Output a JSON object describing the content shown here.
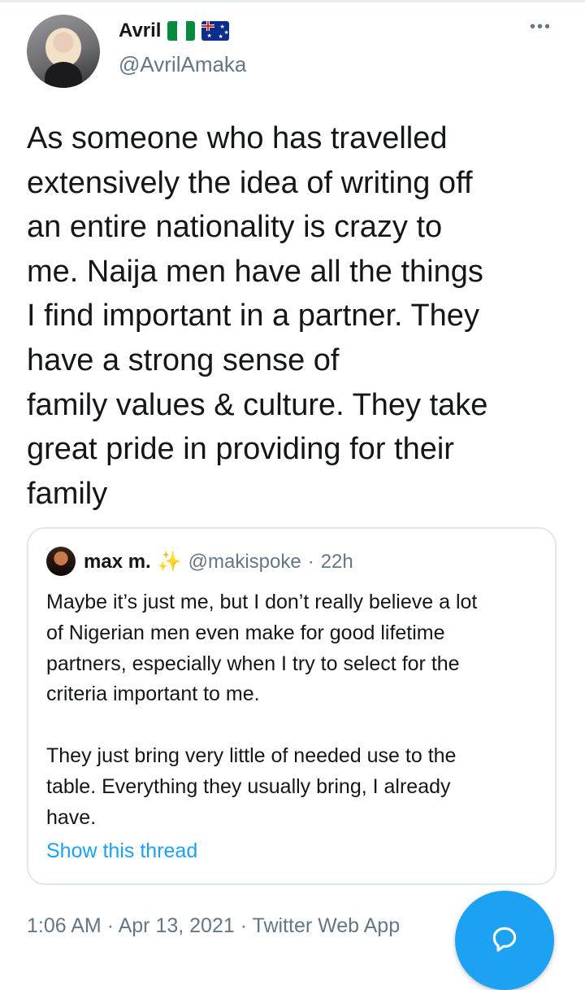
{
  "tweet": {
    "author_name": "Avril",
    "author_handle": "@AvrilAmaka",
    "flags": [
      "nigeria-flag",
      "australia-flag"
    ],
    "more_icon": "more-icon",
    "text": "As someone who has travelled\nextensively the idea of writing off\nan entire nationality is crazy to\nme. Naija men have all the things\nI find important in a partner. They\nhave a strong sense of\nfamily values & culture. They take\ngreat pride in providing for their\nfamily",
    "timestamp": "1:06 AM",
    "date": "Apr 13, 2021",
    "source": "Twitter Web App",
    "meta_separator": "·"
  },
  "quoted_tweet": {
    "author_name": "max m.",
    "emoji": "✨",
    "author_handle": "@makispoke",
    "separator": "·",
    "age": "22h",
    "text": "Maybe it’s just me, but I don’t really believe a lot\nof Nigerian men even make for good lifetime\npartners, especially when I try to select for the\ncriteria important to me.\n\nThey just bring very little of needed use to the\ntable. Everything they usually bring, I already\nhave.",
    "show_thread_label": "Show this thread"
  },
  "fab": {
    "icon": "reply-icon"
  },
  "colors": {
    "accent": "#1da1f2",
    "secondary_text": "#657786",
    "border": "#e1e8ed"
  }
}
